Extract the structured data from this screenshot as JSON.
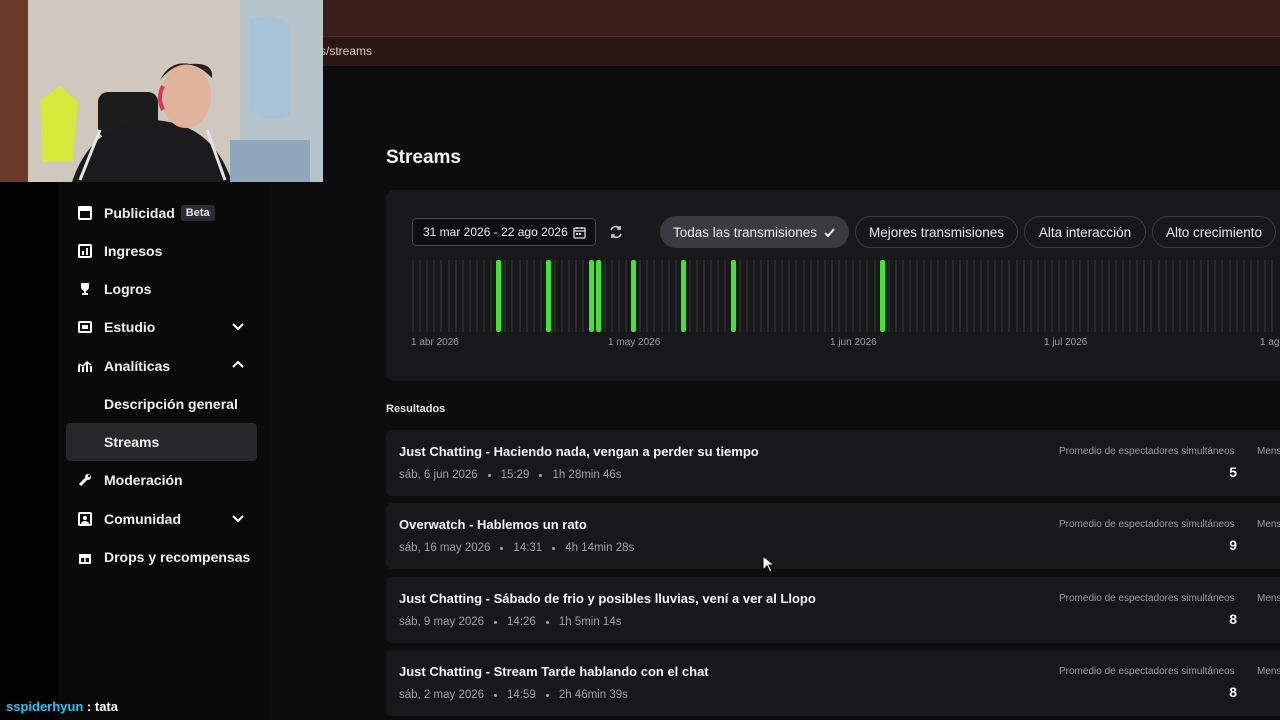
{
  "browser": {
    "url": "s/streams"
  },
  "nav": {
    "items": [
      {
        "name": "nav-publicidad",
        "icon": "calendar-square-icon",
        "label": "Publicidad",
        "badge": "Beta"
      },
      {
        "name": "nav-ingresos",
        "icon": "chart-bar-icon",
        "label": "Ingresos"
      },
      {
        "name": "nav-logros",
        "icon": "trophy-icon",
        "label": "Logros"
      },
      {
        "name": "nav-estudio",
        "icon": "studio-icon",
        "label": "Estudio",
        "chevron": "chevron-down-icon"
      },
      {
        "name": "nav-analiticas",
        "icon": "analytics-icon",
        "label": "Analíticas",
        "chevron": "chevron-up-icon"
      },
      {
        "name": "nav-descripcion-general",
        "label": "Descripción general"
      },
      {
        "name": "nav-streams",
        "label": "Streams",
        "active": true
      },
      {
        "name": "nav-moderacion",
        "icon": "wrench-icon",
        "label": "Moderación"
      },
      {
        "name": "nav-comunidad",
        "icon": "community-icon",
        "label": "Comunidad",
        "chevron": "chevron-down-icon"
      },
      {
        "name": "nav-drops",
        "icon": "gift-icon",
        "label": "Drops y recompensas"
      }
    ]
  },
  "main": {
    "title": "Streams",
    "date_range": "31 mar 2026 - 22 ago 2026",
    "filters": [
      {
        "label": "Todas las transmisiones",
        "active": true
      },
      {
        "label": "Mejores transmisiones"
      },
      {
        "label": "Alta interacción"
      },
      {
        "label": "Alto crecimiento"
      }
    ],
    "timeline": {
      "start_date": "2026-04-01",
      "axis_labels": [
        "1 abr 2026",
        "1 may 2026",
        "1 jun 2026",
        "1 jul 2026",
        "1 ag"
      ],
      "stream_dates": [
        "2026-04-13",
        "2026-04-20",
        "2026-04-26",
        "2026-04-27",
        "2026-05-02",
        "2026-05-09",
        "2026-05-16",
        "2026-06-06"
      ],
      "accent": "#3ee62f"
    },
    "results_title": "Resultados",
    "stat_label": "Promedio de espectadores simultáneos",
    "stat2_label_partial": "Mens",
    "results": [
      {
        "title": "Just Chatting - Haciendo nada, vengan a perder su tiempo",
        "date": "sáb, 6 jun 2026",
        "time": "15:29",
        "duration": "1h 28min 46s",
        "viewers": "5"
      },
      {
        "title": "Overwatch - Hablemos un rato",
        "date": "sáb, 16 may 2026",
        "time": "14:31",
        "duration": "4h 14min 28s",
        "viewers": "9"
      },
      {
        "title": "Just Chatting - Sábado de frio y posibles lluvias, vení a ver al Llopo",
        "date": "sáb, 9 may 2026",
        "time": "14:26",
        "duration": "1h 5min 14s",
        "viewers": "8"
      },
      {
        "title": "Just Chatting - Stream Tarde hablando con el chat",
        "date": "sáb, 2 may 2026",
        "time": "14:59",
        "duration": "2h 46min 39s",
        "viewers": "8"
      }
    ]
  },
  "chat": {
    "user": "sspiderhyun",
    "message": "tata"
  }
}
